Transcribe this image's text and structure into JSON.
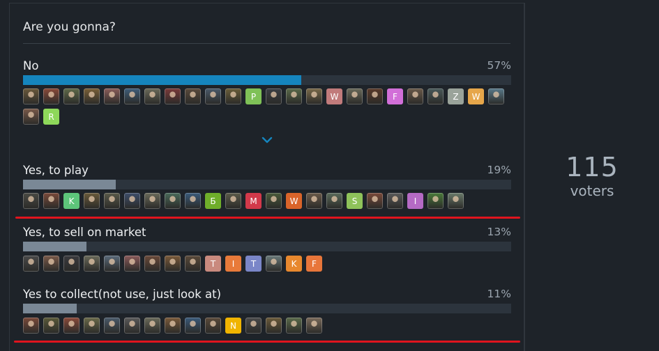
{
  "question": "Are you gonna?",
  "voters": {
    "count": "115",
    "label": "voters"
  },
  "colors": {
    "bar_first": "#1585be",
    "bar_other": "#7a8896",
    "track": "#2c343d",
    "annotation_line": "#e0141e"
  },
  "options": [
    {
      "label": "No",
      "percent": "57%",
      "fill_fraction": 0.57,
      "avatars": [
        {
          "kind": "photo",
          "color": "#6b5a3c"
        },
        {
          "kind": "photo",
          "color": "#8a4a3a"
        },
        {
          "kind": "photo",
          "color": "#5f6a4a"
        },
        {
          "kind": "photo",
          "color": "#7a6038"
        },
        {
          "kind": "photo",
          "color": "#8b5e5a"
        },
        {
          "kind": "photo",
          "color": "#3f5e7a"
        },
        {
          "kind": "photo",
          "color": "#6a6a5a"
        },
        {
          "kind": "photo",
          "color": "#7a3a3a"
        },
        {
          "kind": "photo",
          "color": "#5a4a3c"
        },
        {
          "kind": "photo",
          "color": "#4a5a6a"
        },
        {
          "kind": "photo",
          "color": "#6a5e3a"
        },
        {
          "kind": "letter",
          "letter": "P",
          "color": "#7fc157"
        },
        {
          "kind": "photo",
          "color": "#3a3e44"
        },
        {
          "kind": "photo",
          "color": "#5a6a4a"
        },
        {
          "kind": "photo",
          "color": "#7a6a4a"
        },
        {
          "kind": "letter",
          "letter": "W",
          "color": "#c17b7b"
        },
        {
          "kind": "photo",
          "color": "#6a6a5a"
        },
        {
          "kind": "photo",
          "color": "#5a3a2a"
        },
        {
          "kind": "letter",
          "letter": "F",
          "color": "#d26fd8"
        },
        {
          "kind": "photo",
          "color": "#6a5a4a"
        },
        {
          "kind": "photo",
          "color": "#4a5a5a"
        },
        {
          "kind": "letter",
          "letter": "Z",
          "color": "#9aa39a"
        },
        {
          "kind": "letter",
          "letter": "W",
          "color": "#e6a64a"
        },
        {
          "kind": "photo",
          "color": "#5a7a8a"
        },
        {
          "kind": "photo",
          "color": "#7a5a4a"
        },
        {
          "kind": "letter",
          "letter": "R",
          "color": "#8ed85a"
        }
      ]
    },
    {
      "label": "Yes, to play",
      "percent": "19%",
      "fill_fraction": 0.19,
      "avatars": [
        {
          "kind": "photo",
          "color": "#4a4a44"
        },
        {
          "kind": "photo",
          "color": "#7a4a3a"
        },
        {
          "kind": "letter",
          "letter": "K",
          "color": "#5dc57a"
        },
        {
          "kind": "photo",
          "color": "#6a5a3a"
        },
        {
          "kind": "photo",
          "color": "#5a5a4a"
        },
        {
          "kind": "photo",
          "color": "#3e4e6a"
        },
        {
          "kind": "photo",
          "color": "#6a6a5a"
        },
        {
          "kind": "photo",
          "color": "#4a6a5a"
        },
        {
          "kind": "photo",
          "color": "#3a5a7a"
        },
        {
          "kind": "letter",
          "letter": "Б",
          "color": "#6fae2a"
        },
        {
          "kind": "photo",
          "color": "#5a5a4a"
        },
        {
          "kind": "letter",
          "letter": "M",
          "color": "#d2394a"
        },
        {
          "kind": "photo",
          "color": "#4a5a3a"
        },
        {
          "kind": "letter",
          "letter": "W",
          "color": "#d9642a"
        },
        {
          "kind": "photo",
          "color": "#6a5a4a"
        },
        {
          "kind": "photo",
          "color": "#5a6a5a"
        },
        {
          "kind": "letter",
          "letter": "S",
          "color": "#8ec25a"
        },
        {
          "kind": "photo",
          "color": "#7a4a3a"
        },
        {
          "kind": "photo",
          "color": "#5a5a5a"
        },
        {
          "kind": "letter",
          "letter": "I",
          "color": "#b56ac4"
        },
        {
          "kind": "photo",
          "color": "#4a7a3a"
        },
        {
          "kind": "photo",
          "color": "#6a7a6a"
        }
      ]
    },
    {
      "label": "Yes, to sell on market",
      "percent": "13%",
      "fill_fraction": 0.13,
      "avatars": [
        {
          "kind": "photo",
          "color": "#4a4a4a"
        },
        {
          "kind": "photo",
          "color": "#7a5a4a"
        },
        {
          "kind": "photo",
          "color": "#3a3a3e"
        },
        {
          "kind": "photo",
          "color": "#6a6a5a"
        },
        {
          "kind": "photo",
          "color": "#5a6a7a"
        },
        {
          "kind": "photo",
          "color": "#8a5a5a"
        },
        {
          "kind": "photo",
          "color": "#6a4a3a"
        },
        {
          "kind": "photo",
          "color": "#7a5a3a"
        },
        {
          "kind": "photo",
          "color": "#5a4a3a"
        },
        {
          "kind": "letter",
          "letter": "T",
          "color": "#c98a7e"
        },
        {
          "kind": "letter",
          "letter": "I",
          "color": "#e87a3a"
        },
        {
          "kind": "letter",
          "letter": "T",
          "color": "#7a86c8"
        },
        {
          "kind": "photo",
          "color": "#6a7a7a"
        },
        {
          "kind": "letter",
          "letter": "K",
          "color": "#e8882e"
        },
        {
          "kind": "letter",
          "letter": "F",
          "color": "#e8763a"
        }
      ]
    },
    {
      "label": "Yes to collect(not use, just look at)",
      "percent": "11%",
      "fill_fraction": 0.11,
      "avatars": [
        {
          "kind": "photo",
          "color": "#7a4a3a"
        },
        {
          "kind": "photo",
          "color": "#5a5a3a"
        },
        {
          "kind": "photo",
          "color": "#8a4a3a"
        },
        {
          "kind": "photo",
          "color": "#6a6a4a"
        },
        {
          "kind": "photo",
          "color": "#4a5a6a"
        },
        {
          "kind": "photo",
          "color": "#5a5a5a"
        },
        {
          "kind": "photo",
          "color": "#6a6a5a"
        },
        {
          "kind": "photo",
          "color": "#7a5a3a"
        },
        {
          "kind": "photo",
          "color": "#3a5a7a"
        },
        {
          "kind": "photo",
          "color": "#5a4a3a"
        },
        {
          "kind": "letter",
          "letter": "N",
          "color": "#f0b400"
        },
        {
          "kind": "photo",
          "color": "#4a4a4a"
        },
        {
          "kind": "photo",
          "color": "#6a5a3a"
        },
        {
          "kind": "photo",
          "color": "#5a6a4a"
        },
        {
          "kind": "photo",
          "color": "#7a6a5a"
        }
      ]
    }
  ],
  "expand_icon": "chevron-down-icon"
}
